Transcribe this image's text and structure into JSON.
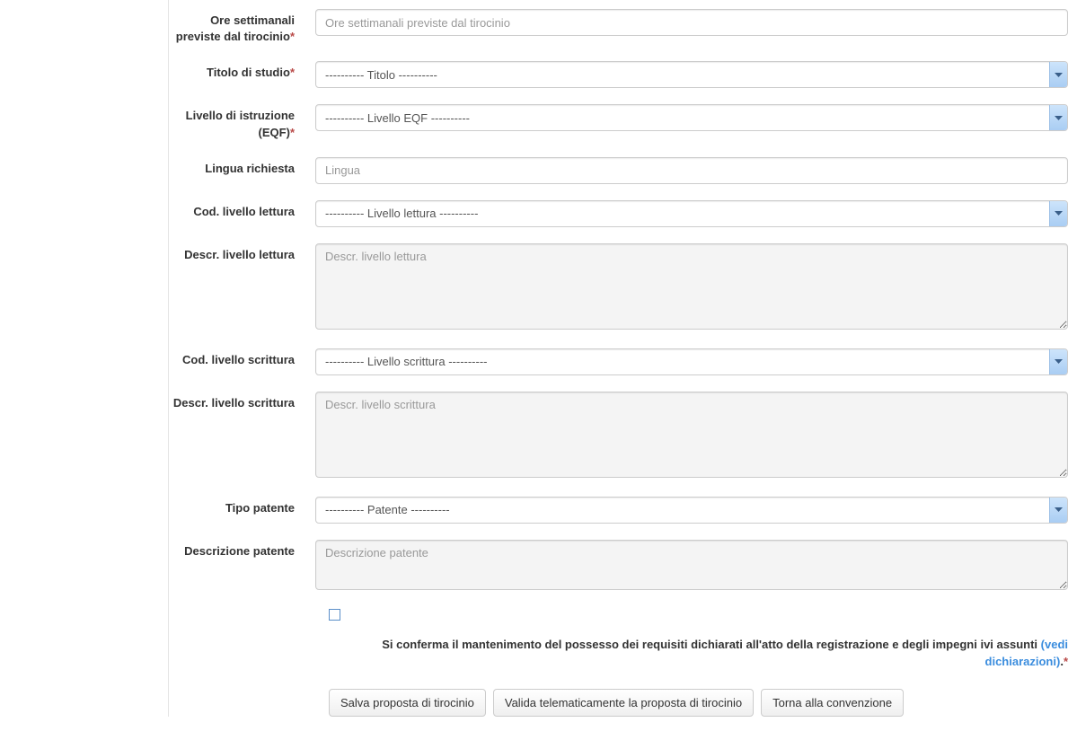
{
  "fields": {
    "ore": {
      "label": "Ore settimanali previste dal tirocinio",
      "required": true,
      "placeholder": "Ore settimanali previste dal tirocinio"
    },
    "titolo": {
      "label": "Titolo di studio",
      "required": true,
      "selected": "---------- Titolo ----------"
    },
    "livello_eqf": {
      "label": "Livello di istruzione (EQF)",
      "required": true,
      "selected": "---------- Livello EQF ----------"
    },
    "lingua": {
      "label": "Lingua richiesta",
      "required": false,
      "placeholder": "Lingua"
    },
    "cod_lettura": {
      "label": "Cod. livello lettura",
      "required": false,
      "selected": "---------- Livello lettura ----------"
    },
    "descr_lettura": {
      "label": "Descr. livello lettura",
      "required": false,
      "placeholder": "Descr. livello lettura"
    },
    "cod_scrittura": {
      "label": "Cod. livello scrittura",
      "required": false,
      "selected": "---------- Livello scrittura ----------"
    },
    "descr_scrittura": {
      "label": "Descr. livello scrittura",
      "required": false,
      "placeholder": "Descr. livello scrittura"
    },
    "tipo_patente": {
      "label": "Tipo patente",
      "required": false,
      "selected": "---------- Patente ----------"
    },
    "descr_patente": {
      "label": "Descrizione patente",
      "required": false,
      "placeholder": "Descrizione patente"
    }
  },
  "confirmation": {
    "text_before": "Si conferma il mantenimento del possesso dei requisiti dichiarati all'atto della registrazione e degli impegni ivi assunti ",
    "link_text": "(vedi dichiarazioni)",
    "text_after": ".",
    "required": true
  },
  "buttons": {
    "save": "Salva proposta di tirocinio",
    "validate": "Valida telematicamente la proposta di tirocinio",
    "back": "Torna alla convenzione"
  },
  "asterisk": "*"
}
